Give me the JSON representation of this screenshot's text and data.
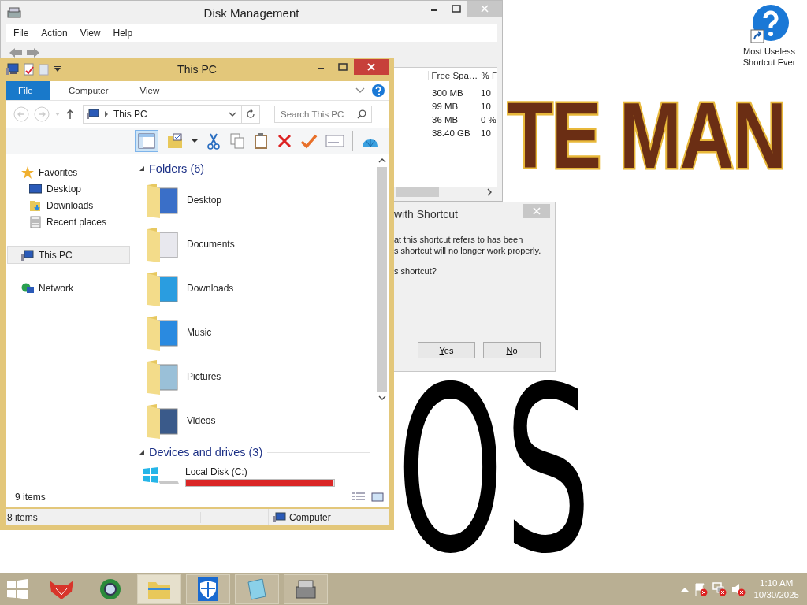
{
  "wallpaper": {
    "texts": [
      "TE MAN",
      "OS"
    ]
  },
  "desktop_icons": [
    {
      "label": "Most Useless Shortcut Ever"
    }
  ],
  "disk_management": {
    "title": "Disk Management",
    "menus": [
      "File",
      "Action",
      "View",
      "Help"
    ],
    "columns": [
      "Free Spa…",
      "% F"
    ],
    "rows": [
      [
        "300 MB",
        "10"
      ],
      [
        "99 MB",
        "10"
      ],
      [
        "36 MB",
        "0 %"
      ],
      [
        "38.40 GB",
        "10"
      ]
    ]
  },
  "dialog": {
    "title": "with Shortcut",
    "lines": [
      "at this shortcut refers to has been",
      "s shortcut will no longer work properly."
    ],
    "question": "s shortcut?",
    "buttons": [
      "Yes",
      "No"
    ]
  },
  "explorer": {
    "title": "This PC",
    "tabs": [
      {
        "label": "File",
        "selected": true
      },
      {
        "label": "Computer",
        "selected": false
      },
      {
        "label": "View",
        "selected": false
      }
    ],
    "address": "This PC",
    "search": {
      "placeholder": "Search This PC"
    },
    "nav": [
      {
        "label": "Favorites",
        "kind": "star",
        "selected": false,
        "children": [
          {
            "label": "Desktop",
            "kind": "desktop",
            "selected": false
          },
          {
            "label": "Downloads",
            "kind": "downloads",
            "selected": false
          },
          {
            "label": "Recent places",
            "kind": "recent",
            "selected": false
          }
        ]
      },
      {
        "label": "This PC",
        "kind": "pc",
        "selected": true
      },
      {
        "label": "Network",
        "kind": "network",
        "selected": false
      }
    ],
    "groups": [
      {
        "title": "Folders (6)",
        "items": [
          {
            "name": "Desktop",
            "kind": "desktop"
          },
          {
            "name": "Documents",
            "kind": "documents"
          },
          {
            "name": "Downloads",
            "kind": "downloads"
          },
          {
            "name": "Music",
            "kind": "music"
          },
          {
            "name": "Pictures",
            "kind": "pictures"
          },
          {
            "name": "Videos",
            "kind": "videos"
          }
        ]
      },
      {
        "title": "Devices and drives (3)",
        "items": [
          {
            "name": "Local Disk (C:)",
            "kind": "drive",
            "level": 0.99
          }
        ]
      }
    ],
    "item_count": "9 items",
    "status_left": "8 items",
    "status_right": "Computer"
  },
  "taskbar": {
    "apps": [
      {
        "kind": "fox",
        "running": false,
        "selected": false
      },
      {
        "kind": "globe",
        "running": false,
        "selected": false
      },
      {
        "kind": "folder",
        "running": true,
        "selected": true
      },
      {
        "kind": "shield",
        "running": true,
        "selected": false
      },
      {
        "kind": "notepad",
        "running": true,
        "selected": false
      },
      {
        "kind": "disk",
        "running": true,
        "selected": false
      }
    ],
    "time": "1:10 AM",
    "date": "10/30/2025"
  }
}
